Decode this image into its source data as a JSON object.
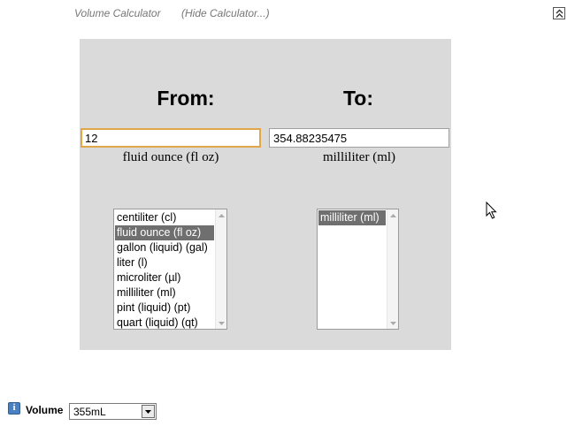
{
  "header": {
    "title": "Volume Calculator",
    "hide_link": "(Hide Calculator...)"
  },
  "converter": {
    "from_heading": "From:",
    "to_heading": "To:",
    "from_value": "12",
    "to_value": "354.88235475",
    "from_unit": "fluid ounce (fl oz)",
    "to_unit": "milliliter (ml)",
    "from_units": [
      "centiliter (cl)",
      "fluid ounce (fl oz)",
      "gallon (liquid) (gal)",
      "liter (l)",
      "microliter (µl)",
      "milliliter (ml)",
      "pint (liquid) (pt)",
      "quart (liquid) (qt)"
    ],
    "from_selected_index": 1,
    "to_units": [
      "milliliter (ml)"
    ],
    "to_selected_index": 0
  },
  "footer": {
    "label": "Volume",
    "select_value": "355mL"
  },
  "colors": {
    "panel_bg": "#dadada",
    "selected_bg": "#6f6f6f",
    "focus_border": "#e3a646",
    "header_text": "#777777",
    "info_icon": "#4a7fc1"
  },
  "icons": {
    "collapse": "double-chevron-up-icon",
    "info": "info-icon",
    "cursor": "mouse-cursor-icon",
    "dropdown": "chevron-down-icon"
  }
}
